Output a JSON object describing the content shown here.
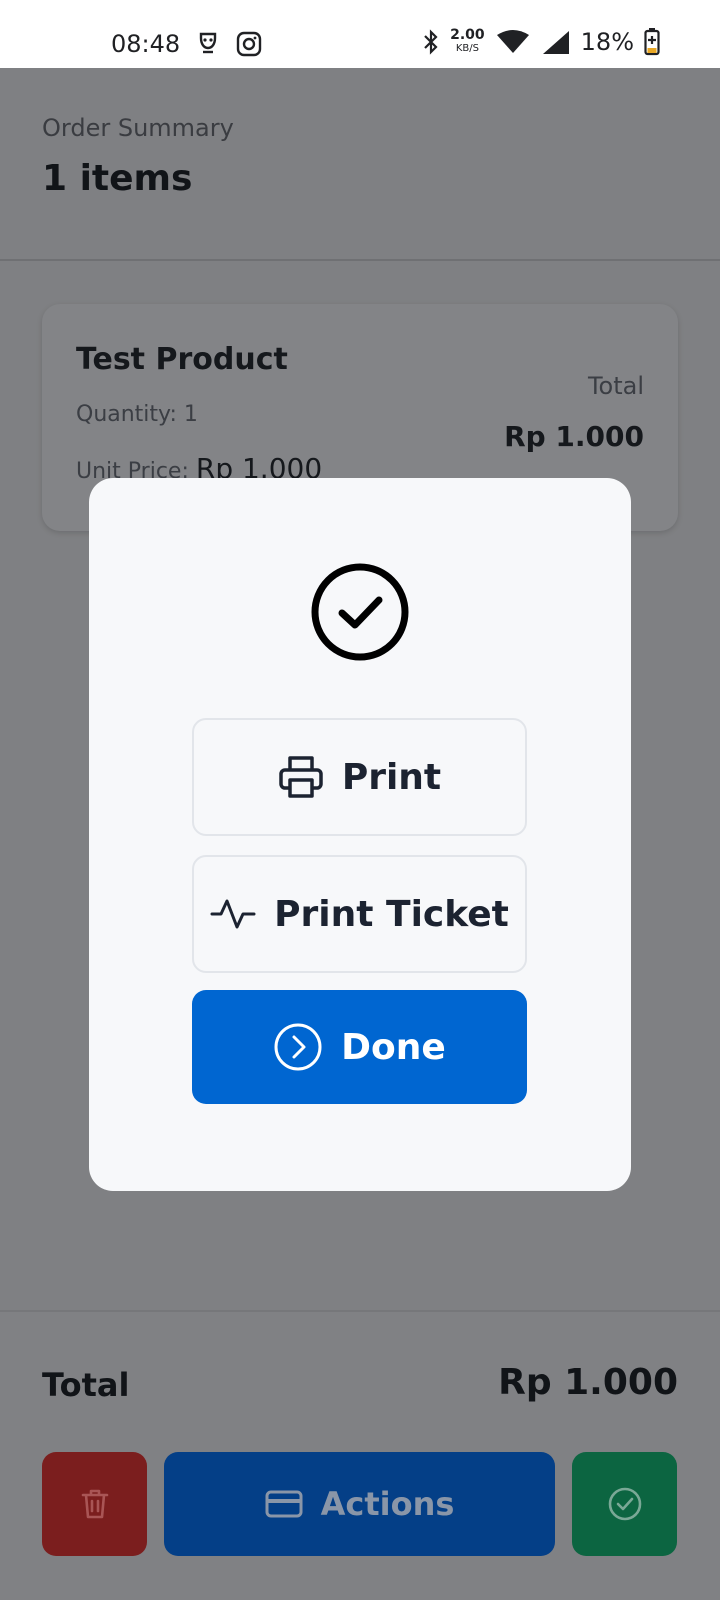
{
  "status_bar": {
    "time": "08:48",
    "network_speed": "2.00",
    "network_unit": "KB/S",
    "battery": "18%"
  },
  "order": {
    "summary_label": "Order Summary",
    "items_count": "1 items"
  },
  "product": {
    "name": "Test Product",
    "quantity": "Quantity: 1",
    "unit_price_label": "Unit Price: ",
    "unit_price_value": "Rp 1.000",
    "total_label": "Total",
    "total_value": "Rp 1.000"
  },
  "footer": {
    "total_label": "Total",
    "total_value": "Rp 1.000",
    "actions_label": "Actions"
  },
  "modal": {
    "print_label": "Print",
    "print_ticket_label": "Print Ticket",
    "done_label": "Done"
  },
  "colors": {
    "primary": "#0066d1",
    "delete": "#7b1e1e",
    "confirm": "#0c6541"
  }
}
